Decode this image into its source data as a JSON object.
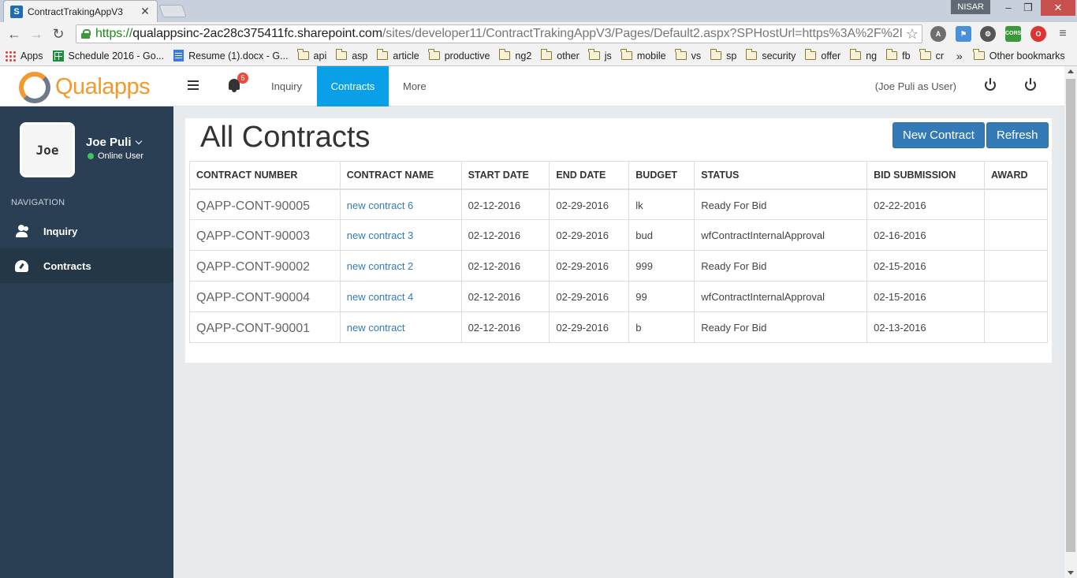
{
  "browser": {
    "tab_title": "ContractTrakingAppV3",
    "tab_favicon": "S",
    "profile_name": "NISAR",
    "url_scheme": "https://",
    "url_host": "qualappsinc-2ac28c375411fc.sharepoint.com",
    "url_path": "/sites/developer11/ContractTrakingAppV3/Pages/Default2.aspx?SPHostUrl=https%3A%2F%2I",
    "extension_cors_label": "CORS"
  },
  "bookmarks": {
    "items": [
      "Apps",
      "Schedule 2016 - Go...",
      "Resume (1).docx - G...",
      "api",
      "asp",
      "article",
      "productive",
      "ng2",
      "other",
      "js",
      "mobile",
      "vs",
      "sp",
      "security",
      "offer",
      "ng",
      "fb",
      "cr"
    ],
    "overflow": "»",
    "other": "Other bookmarks"
  },
  "header": {
    "logo_text": "Qualapps",
    "notification_count": "5",
    "nav": [
      "Inquiry",
      "Contracts",
      "More"
    ],
    "active_nav": "Contracts",
    "user_role": "(Joe Puli as User)"
  },
  "sidebar": {
    "avatar_text": "Joe",
    "user_name": "Joe Puli",
    "user_status": "Online User",
    "status_color": "#3fc35a",
    "section_heading": "NAVIGATION",
    "items": [
      {
        "label": "Inquiry",
        "icon": "users-icon"
      },
      {
        "label": "Contracts",
        "icon": "dashboard-icon"
      }
    ]
  },
  "main": {
    "title": "All Contracts",
    "new_button": "New Contract",
    "refresh_button": "Refresh",
    "columns": [
      "CONTRACT NUMBER",
      "CONTRACT NAME",
      "START DATE",
      "END DATE",
      "BUDGET",
      "STATUS",
      "BID SUBMISSION",
      "AWARD"
    ],
    "rows": [
      [
        "QAPP-CONT-90005",
        "new contract 6",
        "02-12-2016",
        "02-29-2016",
        "lk",
        "Ready For Bid",
        "02-22-2016",
        ""
      ],
      [
        "QAPP-CONT-90003",
        "new contract 3",
        "02-12-2016",
        "02-29-2016",
        "bud",
        "wfContractInternalApproval",
        "02-16-2016",
        ""
      ],
      [
        "QAPP-CONT-90002",
        "new contract 2",
        "02-12-2016",
        "02-29-2016",
        "999",
        "Ready For Bid",
        "02-15-2016",
        ""
      ],
      [
        "QAPP-CONT-90004",
        "new contract 4",
        "02-12-2016",
        "02-29-2016",
        "99",
        "wfContractInternalApproval",
        "02-15-2016",
        ""
      ],
      [
        "QAPP-CONT-90001",
        "new contract",
        "02-12-2016",
        "02-29-2016",
        "b",
        "Ready For Bid",
        "02-13-2016",
        ""
      ]
    ]
  },
  "colors": {
    "sidebar_bg": "#2a3f54",
    "active_nav_bg": "#0aa0e8",
    "primary_button": "#337ab7",
    "logo_orange": "#f29a2e",
    "link": "#337ab7"
  }
}
